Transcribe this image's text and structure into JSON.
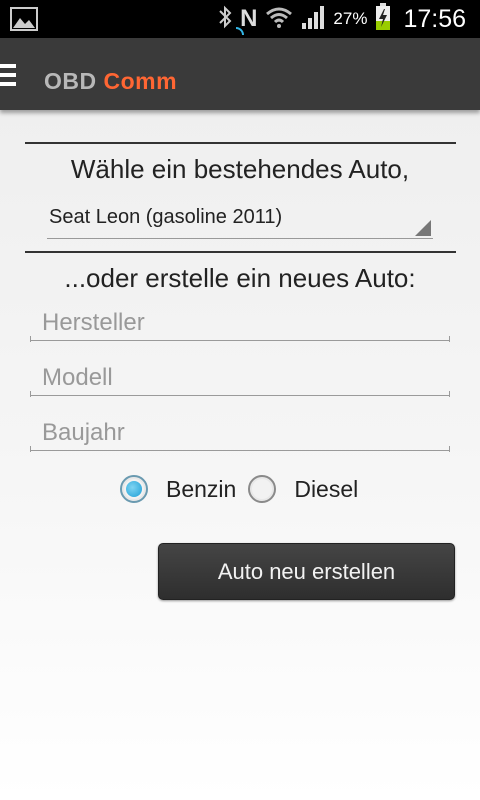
{
  "status_bar": {
    "battery_percent": "27%",
    "time": "17:56",
    "nfc_letter": "N",
    "icons": [
      "image-icon",
      "bluetooth-icon",
      "nfc-icon",
      "wifi-icon",
      "signal-icon",
      "battery-charging-icon"
    ]
  },
  "action_bar": {
    "title_part1": "OBD",
    "title_part2": "Comm",
    "accent_color": "#ff6633"
  },
  "existing_car": {
    "heading": "Wähle ein bestehendes Auto,",
    "selected": "Seat Leon (gasoline 2011)"
  },
  "new_car": {
    "heading": "...oder erstelle ein neues Auto:",
    "manufacturer_placeholder": "Hersteller",
    "model_placeholder": "Modell",
    "year_placeholder": "Baujahr",
    "fuel_options": [
      {
        "label": "Benzin",
        "selected": true
      },
      {
        "label": "Diesel",
        "selected": false
      }
    ],
    "create_button": "Auto neu erstellen"
  }
}
